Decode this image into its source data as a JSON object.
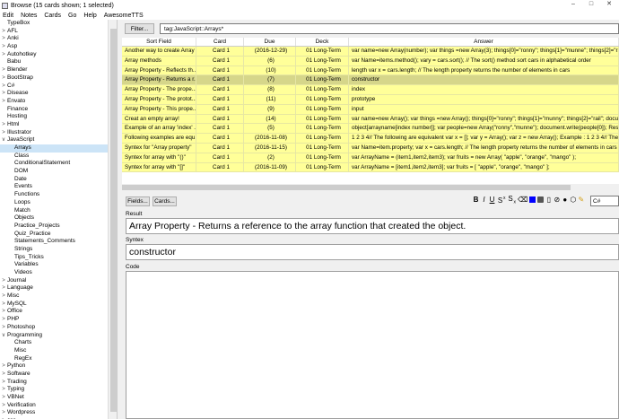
{
  "window": {
    "title": "Browse (15 cards shown; 1 selected)",
    "controls": [
      "–",
      "□",
      "✕"
    ]
  },
  "menu": [
    "Edit",
    "Notes",
    "Cards",
    "Go",
    "Help",
    "AwesomeTTS"
  ],
  "sidebar": [
    {
      "label": "TypeBox",
      "arrow": "",
      "indent": 0
    },
    {
      "label": "AFL",
      "arrow": ">",
      "indent": 0
    },
    {
      "label": "Anki",
      "arrow": ">",
      "indent": 0
    },
    {
      "label": "Asp",
      "arrow": ">",
      "indent": 0
    },
    {
      "label": "Autohotkey",
      "arrow": ">",
      "indent": 0
    },
    {
      "label": "Babu",
      "arrow": "",
      "indent": 0
    },
    {
      "label": "Blender",
      "arrow": ">",
      "indent": 0
    },
    {
      "label": "BootStrap",
      "arrow": ">",
      "indent": 0
    },
    {
      "label": "C#",
      "arrow": ">",
      "indent": 0
    },
    {
      "label": "Disease",
      "arrow": ">",
      "indent": 0
    },
    {
      "label": "Envato",
      "arrow": ">",
      "indent": 0
    },
    {
      "label": "Finance",
      "arrow": "",
      "indent": 0
    },
    {
      "label": "Hosting",
      "arrow": "",
      "indent": 0
    },
    {
      "label": "Html",
      "arrow": ">",
      "indent": 0
    },
    {
      "label": "Illustrator",
      "arrow": ">",
      "indent": 0
    },
    {
      "label": "JavaScript",
      "arrow": "∨",
      "indent": 0
    },
    {
      "label": "Arrays",
      "arrow": "",
      "indent": 1,
      "selected": true
    },
    {
      "label": "Class",
      "arrow": "",
      "indent": 1
    },
    {
      "label": "ConditionalStatement",
      "arrow": "",
      "indent": 1
    },
    {
      "label": "DOM",
      "arrow": "",
      "indent": 1
    },
    {
      "label": "Date",
      "arrow": "",
      "indent": 1
    },
    {
      "label": "Events",
      "arrow": "",
      "indent": 1
    },
    {
      "label": "Functions",
      "arrow": "",
      "indent": 1
    },
    {
      "label": "Loops",
      "arrow": "",
      "indent": 1
    },
    {
      "label": "Match",
      "arrow": "",
      "indent": 1
    },
    {
      "label": "Objects",
      "arrow": "",
      "indent": 1
    },
    {
      "label": "Practice_Projects",
      "arrow": "",
      "indent": 1
    },
    {
      "label": "Quiz_Practice",
      "arrow": "",
      "indent": 1
    },
    {
      "label": "Statements_Comments",
      "arrow": "",
      "indent": 1
    },
    {
      "label": "Strings",
      "arrow": "",
      "indent": 1
    },
    {
      "label": "Tips_Tricks",
      "arrow": "",
      "indent": 1
    },
    {
      "label": "Variables",
      "arrow": "",
      "indent": 1
    },
    {
      "label": "Videos",
      "arrow": "",
      "indent": 1
    },
    {
      "label": "Journal",
      "arrow": ">",
      "indent": 0
    },
    {
      "label": "Language",
      "arrow": ">",
      "indent": 0
    },
    {
      "label": "Misc",
      "arrow": ">",
      "indent": 0
    },
    {
      "label": "MySQL",
      "arrow": ">",
      "indent": 0
    },
    {
      "label": "Office",
      "arrow": ">",
      "indent": 0
    },
    {
      "label": "PHP",
      "arrow": ">",
      "indent": 0
    },
    {
      "label": "Photoshop",
      "arrow": ">",
      "indent": 0
    },
    {
      "label": "Programming",
      "arrow": "∨",
      "indent": 0
    },
    {
      "label": "Charts",
      "arrow": "",
      "indent": 1
    },
    {
      "label": "Misc",
      "arrow": "",
      "indent": 1
    },
    {
      "label": "RegEx",
      "arrow": "",
      "indent": 1
    },
    {
      "label": "Python",
      "arrow": ">",
      "indent": 0
    },
    {
      "label": "Software",
      "arrow": ">",
      "indent": 0
    },
    {
      "label": "Trading",
      "arrow": ">",
      "indent": 0
    },
    {
      "label": "Typing",
      "arrow": ">",
      "indent": 0
    },
    {
      "label": "VBNet",
      "arrow": ">",
      "indent": 0
    },
    {
      "label": "Verification",
      "arrow": ">",
      "indent": 0
    },
    {
      "label": "Wordpress",
      "arrow": ">",
      "indent": 0
    },
    {
      "label": "css",
      "arrow": ">",
      "indent": 0
    }
  ],
  "toolbar": {
    "filter_label": "Filter...",
    "search_value": "tag:JavaScript::Arrays*"
  },
  "table": {
    "columns": [
      "Sort Field",
      "Card",
      "Due",
      "Deck",
      "Answer"
    ],
    "rows": [
      [
        "Another way to create Array :",
        "Card 1",
        "(2016-12-29)",
        "01 Long-Term",
        "var name=new Array(number);      var things =new Array(3); things[0]=\"ronny\"; things[1]=\"munne\"; things[2]=\"rail\"; doc"
      ],
      [
        "Array methods",
        "Card 1",
        "(6)",
        "01 Long-Term",
        "var Name=items.method();      vary = cars.sort();         // The sort() method sort cars in alphabetical order"
      ],
      [
        "Array Property -  Reflects th...",
        "Card 1",
        "(10)",
        "01 Long-Term",
        "length    var x = cars.length;         // The length property returns the number of elements in cars"
      ],
      [
        "Array Property -  Returns a r...",
        "Card 1",
        "(7)",
        "01 Long-Term",
        "constructor"
      ],
      [
        "Array Property -  The prope...",
        "Card 1",
        "(8)",
        "01 Long-Term",
        "index"
      ],
      [
        "Array Property -  The protot...",
        "Card 1",
        "(11)",
        "01 Long-Term",
        "prototype"
      ],
      [
        "Array Property -  This prope...",
        "Card 1",
        "(9)",
        "01 Long-Term",
        "input"
      ],
      [
        "Creat an empty array!",
        "Card 1",
        "(14)",
        "01 Long-Term",
        "var name=new Array();       var things =new Array(); things[0]=\"ronny\"; things[1]=\"munny\"; things[2]=\"rail\"; document.wri"
      ],
      [
        "Example of an array 'index' ...",
        "Card 1",
        "(5)",
        "01 Long-Term",
        "object[arrayname[index number]];       var people=new Array(\"ronny\",\"munne\"); document.write(people[0]);   Result: ronny"
      ],
      [
        "Following examples are equ...",
        "Card 1",
        "(2016-11-08)",
        "01 Long-Term",
        "1 2 3 4// The following are equivalent var x = []; var y = Array(); var z = new Array();    Example : 1 2 3 4// The following are"
      ],
      [
        "Syntex for \"Array property\"",
        "Card 1",
        "(2016-11-15)",
        "01 Long-Term",
        "var Name=item.property;      var x = cars.length;         // The length property returns the number of elements in cars"
      ],
      [
        "Syntex for array with \"()\"",
        "Card 1",
        "(2)",
        "01 Long-Term",
        "var ArrayName = (item1,item2,item3);     var fruits = new Array( \"apple\", \"orange\", \"mango\" );"
      ],
      [
        "Syntex for array with \"[]\"",
        "Card 1",
        "(2016-11-09)",
        "01 Long-Term",
        "var ArrayName = [item1,item2,item3];     var fruits = [ \"apple\", \"orange\", \"mango\" ];"
      ]
    ],
    "selected_index": 3
  },
  "editor": {
    "fields_label": "Fields...",
    "cards_label": "Cards...",
    "format_buttons": [
      "B",
      "I",
      "U",
      "S",
      "S",
      "x"
    ],
    "tags_value": "C#",
    "fields": [
      {
        "label": "Result",
        "value": "Array Property - Returns a reference to the array function that created the object."
      },
      {
        "label": "Syntex",
        "value": "constructor"
      },
      {
        "label": "Code",
        "value": ""
      }
    ]
  },
  "colors": {
    "row_bg": "#ffff99",
    "selected_row_bg": "#d6d68a",
    "sidebar_selected": "#cce4f7"
  }
}
